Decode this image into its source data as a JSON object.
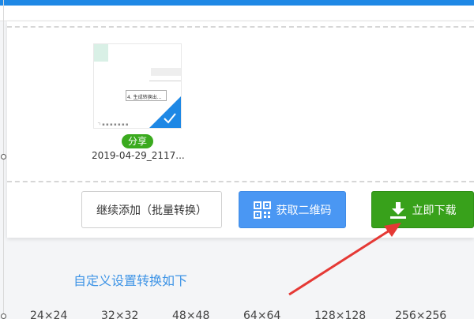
{
  "file": {
    "share_label": "分享",
    "name": "2019-04-29_2117..."
  },
  "thumbnail": {
    "doc_text": "4. 生成转换出...",
    "doc_footer": "ㄱ ▪ ▪ ▪ ▪  ▪ ▪ ▪"
  },
  "actions": {
    "continue_label": "继续添加（批量转换）",
    "qr_label": "获取二维码",
    "download_label": "立即下载"
  },
  "settings": {
    "title": "自定义设置转换如下",
    "sizes": [
      "24×24",
      "32×32",
      "48×48",
      "64×64",
      "128×128",
      "256×256"
    ]
  },
  "colors": {
    "accent_blue": "#1e88e5",
    "share_green": "#3aaa1e",
    "download_green": "#38a11b",
    "qr_blue": "#4a97f3",
    "annotation_red": "#e53935"
  }
}
